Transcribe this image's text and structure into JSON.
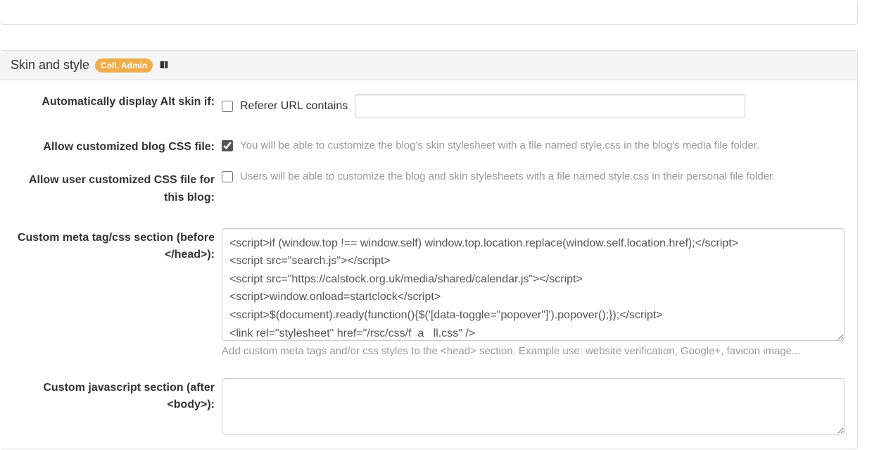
{
  "panel": {
    "title": "Skin and style",
    "badge": "Coll. Admin"
  },
  "fields": {
    "alt_skin": {
      "label": "Automatically display Alt skin if:",
      "checkbox_label": "Referer URL contains",
      "value": ""
    },
    "allow_blog_css": {
      "label": "Allow customized blog CSS file:",
      "help": "You will be able to customize the blog's skin stylesheet with a file named style.css in the blog's media file folder."
    },
    "allow_user_css": {
      "label": "Allow user customized CSS file for this blog:",
      "help": "Users will be able to customize the blog and skin stylesheets with a file named style.css in their personal file folder."
    },
    "custom_head": {
      "label": "Custom meta tag/css section (before </head>):",
      "value": "<script>if (window.top !== window.self) window.top.location.replace(window.self.location.href);</script>\n<script src=\"search.js\"></script>\n<script src=\"https://calstock.org.uk/media/shared/calendar.js\"></script>\n<script>window.onload=startclock</script>\n<script>$(document).ready(function(){$('[data-toggle=\"popover\"]').popover();});</script>\n<link rel=\"stylesheet\" href=\"/rsc/css/f  a   ll.css\" />",
      "help": "Add custom meta tags and/or css styles to the <head> section. Example use: website verification, Google+, favicon image..."
    },
    "custom_body": {
      "label": "Custom javascript section (after <body>):",
      "value": ""
    }
  }
}
